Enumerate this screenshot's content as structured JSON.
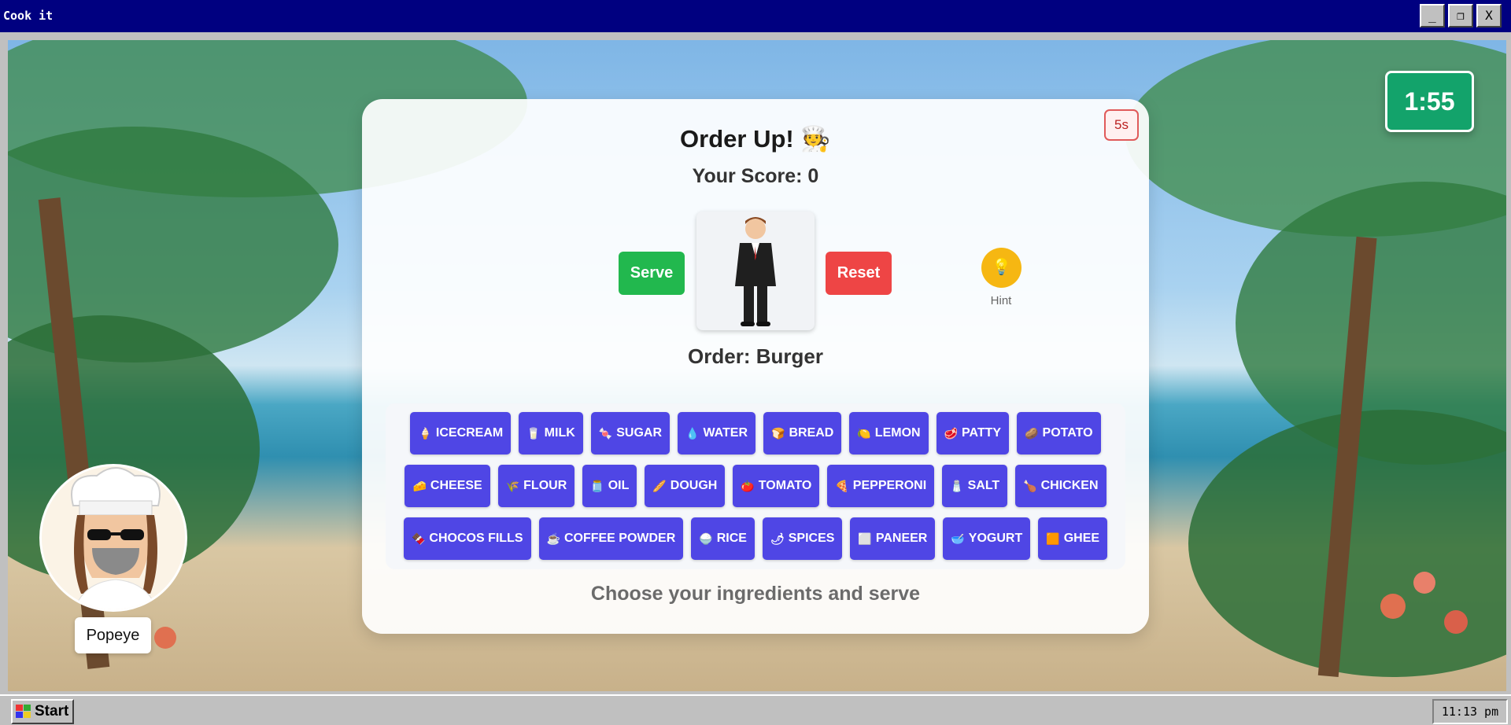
{
  "window": {
    "title": "Cook it",
    "min_label": "_",
    "max_label": "❐",
    "close_label": "X"
  },
  "timer": {
    "value": "1:55"
  },
  "panel": {
    "title": "Order Up! 🧑‍🍳",
    "score_label": "Your Score: 0",
    "countdown_badge": "5s",
    "serve_label": "Serve",
    "reset_label": "Reset",
    "hint_icon": "💡",
    "hint_label": "Hint",
    "order_label": "Order: Burger",
    "instruction": "Choose your ingredients and serve"
  },
  "ingredients": {
    "rows": [
      [
        {
          "icon": "🍦",
          "label": "ICECREAM"
        },
        {
          "icon": "🥛",
          "label": "MILK"
        },
        {
          "icon": "🍬",
          "label": "SUGAR"
        },
        {
          "icon": "💧",
          "label": "WATER"
        },
        {
          "icon": "🍞",
          "label": "BREAD"
        },
        {
          "icon": "🍋",
          "label": "LEMON"
        },
        {
          "icon": "🥩",
          "label": "PATTY"
        },
        {
          "icon": "🥔",
          "label": "POTATO"
        }
      ],
      [
        {
          "icon": "🧀",
          "label": "CHEESE"
        },
        {
          "icon": "🌾",
          "label": "FLOUR"
        },
        {
          "icon": "🫙",
          "label": "OIL"
        },
        {
          "icon": "🥖",
          "label": "DOUGH"
        },
        {
          "icon": "🍅",
          "label": "TOMATO"
        },
        {
          "icon": "🍕",
          "label": "PEPPERONI"
        },
        {
          "icon": "🧂",
          "label": "SALT"
        },
        {
          "icon": "🍗",
          "label": "CHICKEN"
        }
      ],
      [
        {
          "icon": "🍫",
          "label": "CHOCOS FILLS"
        },
        {
          "icon": "☕",
          "label": "COFFEE POWDER"
        },
        {
          "icon": "🍚",
          "label": "RICE"
        },
        {
          "icon": "🌶",
          "label": "SPICES"
        },
        {
          "icon": "⬜",
          "label": "PANEER"
        },
        {
          "icon": "🥣",
          "label": "YOGURT"
        },
        {
          "icon": "🟧",
          "label": "GHEE"
        }
      ]
    ]
  },
  "player": {
    "name": "Popeye"
  },
  "taskbar": {
    "start_label": "Start",
    "clock": "11:13 pm"
  }
}
